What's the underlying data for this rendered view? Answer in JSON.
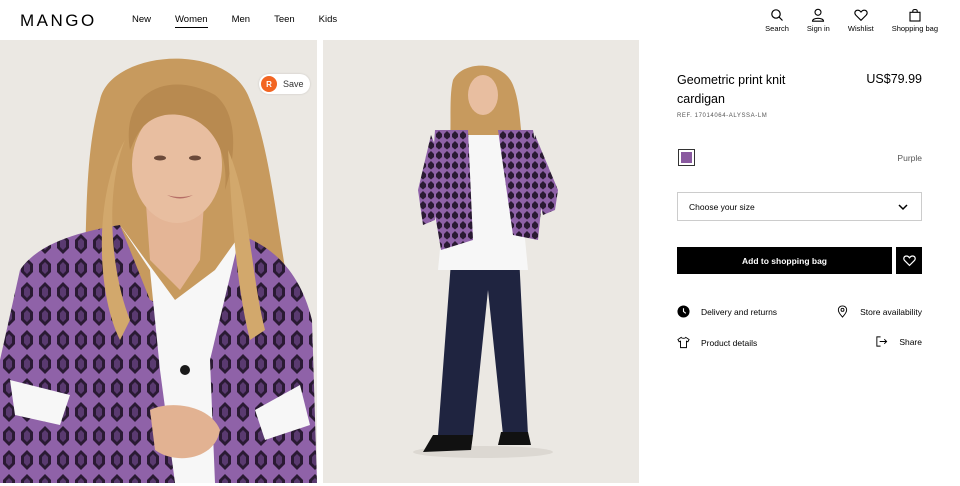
{
  "header": {
    "logo": "MANGO",
    "nav": [
      {
        "label": "New",
        "active": false
      },
      {
        "label": "Women",
        "active": true
      },
      {
        "label": "Men",
        "active": false
      },
      {
        "label": "Teen",
        "active": false
      },
      {
        "label": "Kids",
        "active": false
      }
    ],
    "actions": [
      {
        "label": "Search",
        "icon": "search-icon"
      },
      {
        "label": "Sign in",
        "icon": "user-icon"
      },
      {
        "label": "Wishlist",
        "icon": "heart-icon"
      },
      {
        "label": "Shopping bag",
        "icon": "bag-icon"
      }
    ]
  },
  "images": {
    "save_logo": "R",
    "save_label": "Save"
  },
  "product": {
    "title": "Geometric print knit cardigan",
    "price": "US$79.99",
    "ref": "REF. 17014064-ALYSSA-LM",
    "color_name": "Purple",
    "color_hex": "#8a5aa0",
    "size_placeholder": "Choose your size",
    "add_label": "Add to shopping bag",
    "links": {
      "delivery": "Delivery and returns",
      "store": "Store availability",
      "details": "Product details",
      "share": "Share"
    }
  }
}
